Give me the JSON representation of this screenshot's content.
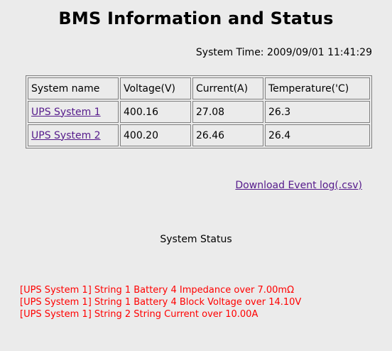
{
  "page": {
    "title": "BMS Information and Status",
    "system_time": "System Time: 2009/09/01 11:41:29"
  },
  "table": {
    "headers": {
      "name": "System name",
      "voltage": "Voltage(V)",
      "current": "Current(A)",
      "temperature": "Temperature('C)"
    },
    "rows": [
      {
        "name": "UPS System 1",
        "voltage": "400.16",
        "current": "27.08",
        "temperature": "26.3"
      },
      {
        "name": "UPS System 2",
        "voltage": "400.20",
        "current": "26.46",
        "temperature": "26.4"
      }
    ]
  },
  "download": {
    "label": "Download Event log(.csv)"
  },
  "status": {
    "heading": "System Status",
    "alerts": [
      "[UPS System 1] String 1 Battery 4 Impedance over 7.00mΩ",
      "[UPS System 1] String 1 Battery 4 Block Voltage over 14.10V",
      "[UPS System 1] String 2 String Current over 10.00A"
    ]
  },
  "colors": {
    "background": "#ebebeb",
    "link": "#551a8b",
    "alert": "#ff0000",
    "border": "#808080"
  }
}
